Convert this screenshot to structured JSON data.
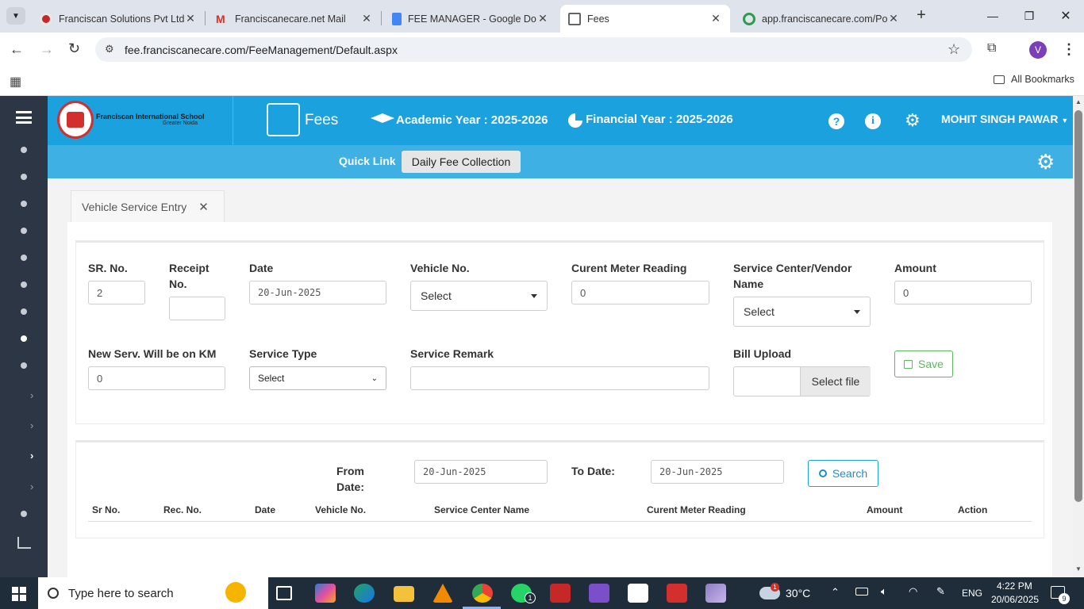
{
  "browser": {
    "tabs": [
      {
        "title": "Franciscan Solutions Pvt Ltd.",
        "icon": "franciscan-favicon",
        "active": false
      },
      {
        "title": "Franciscanecare.net Mail",
        "icon": "gmail-icon",
        "active": false
      },
      {
        "title": "FEE MANAGER - Google Do",
        "icon": "google-docs-icon",
        "active": false
      },
      {
        "title": "Fees",
        "icon": "fees-favicon",
        "active": true
      },
      {
        "title": "app.franciscanecare.com/Po",
        "icon": "app-favicon",
        "active": false
      }
    ],
    "url": "fee.franciscanecare.com/FeeManagement/Default.aspx",
    "profile_initial": "V",
    "bookmarks_label": "All Bookmarks"
  },
  "header": {
    "school_name": "Franciscan International School",
    "school_location": "Greater Noida",
    "module": "Fees",
    "academic_year": "Academic Year : 2025-2026",
    "financial_year": "Financial Year : 2025-2026",
    "user": "MOHIT SINGH PAWAR"
  },
  "quickbar": {
    "label": "Quick Link",
    "link": "Daily Fee Collection"
  },
  "page_tab": "Vehicle Service Entry",
  "form": {
    "sr_label": "SR. No.",
    "sr_value": "2",
    "receipt_label": "Receipt No.",
    "receipt_value": "",
    "date_label": "Date",
    "date_value": "20-Jun-2025",
    "vehicle_label": "Vehicle No.",
    "vehicle_value": "Select",
    "meter_label": "Curent Meter Reading",
    "meter_value": "0",
    "vendor_label": "Service Center/Vendor Name",
    "vendor_value": "Select",
    "amount_label": "Amount",
    "amount_value": "0",
    "next_km_label": "New Serv. Will be on KM",
    "next_km_value": "0",
    "service_type_label": "Service Type",
    "service_type_value": "Select",
    "remark_label": "Service Remark",
    "remark_value": "",
    "bill_label": "Bill Upload",
    "bill_button": "Select file",
    "save_button": "Save"
  },
  "search": {
    "from_label": "From Date:",
    "from_value": "20-Jun-2025",
    "to_label": "To Date:",
    "to_value": "20-Jun-2025",
    "search_button": "Search"
  },
  "table": {
    "columns": [
      "Sr No.",
      "Rec. No.",
      "Date",
      "Vehicle No.",
      "Service Center Name",
      "Curent Meter Reading",
      "Amount",
      "Action"
    ]
  },
  "taskbar": {
    "search_placeholder": "Type here to search",
    "weather": "30°C",
    "language": "ENG",
    "time": "4:22 PM",
    "date": "20/06/2025",
    "notification_count": "9",
    "whatsapp_badge": "1",
    "weather_badge": "1"
  },
  "colors": {
    "header": "#1aa1de",
    "quickbar": "#3fb0e4",
    "sidebar": "#2c3644",
    "save": "#5cb85c",
    "search": "#1aa1de"
  }
}
